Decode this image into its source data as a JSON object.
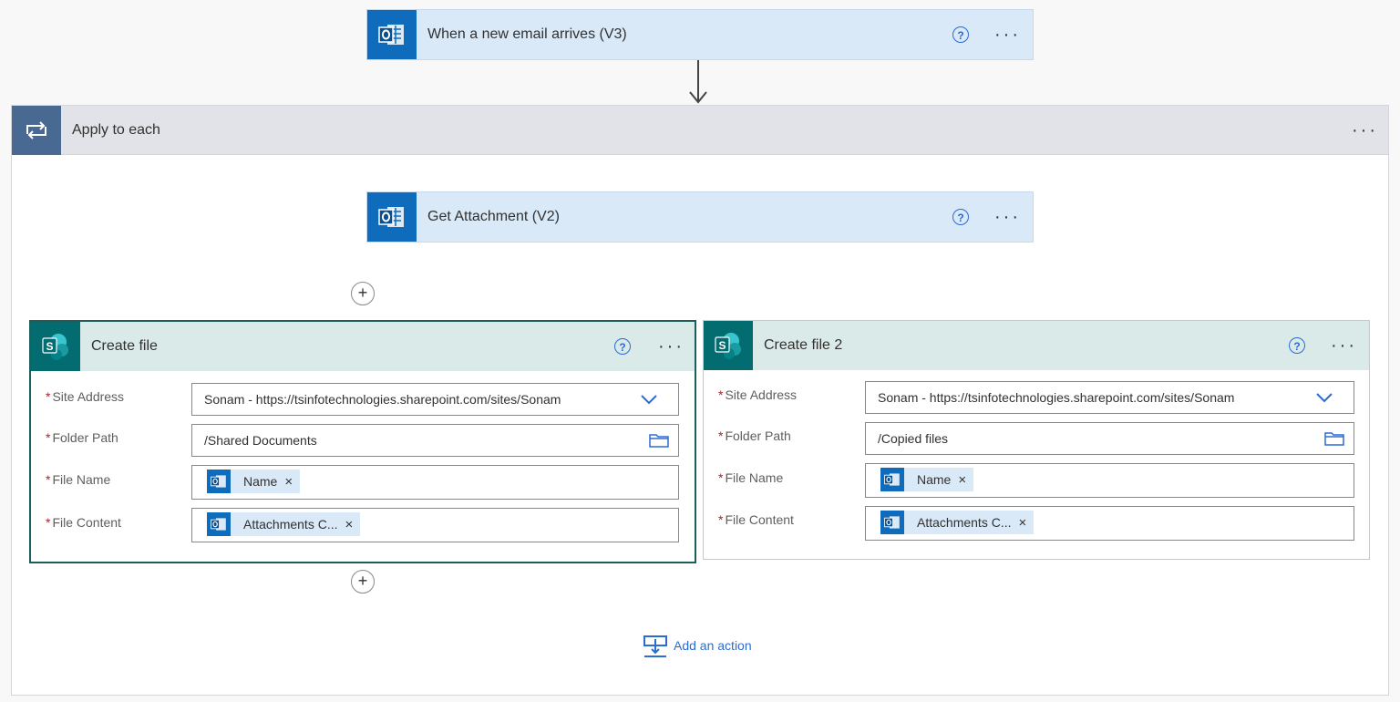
{
  "trigger": {
    "title": "When a new email arrives (V3)",
    "help": "?",
    "more": "···",
    "icon": "outlook-icon"
  },
  "loop": {
    "title": "Apply to each",
    "more": "···",
    "icon": "loop-icon"
  },
  "get_attachment": {
    "title": "Get Attachment (V2)",
    "help": "?",
    "more": "···",
    "icon": "outlook-icon"
  },
  "create_file": {
    "title": "Create file",
    "help": "?",
    "more": "···",
    "icon": "sharepoint-icon",
    "fields": {
      "site_address": {
        "label": "Site Address",
        "value": "Sonam - https://tsinfotechnologies.sharepoint.com/sites/Sonam"
      },
      "folder_path": {
        "label": "Folder Path",
        "value": "/Shared Documents"
      },
      "file_name": {
        "label": "File Name",
        "token": "Name"
      },
      "file_content": {
        "label": "File Content",
        "token": "Attachments C..."
      }
    }
  },
  "create_file_2": {
    "title": "Create file 2",
    "help": "?",
    "more": "···",
    "icon": "sharepoint-icon",
    "fields": {
      "site_address": {
        "label": "Site Address",
        "value": "Sonam - https://tsinfotechnologies.sharepoint.com/sites/Sonam"
      },
      "folder_path": {
        "label": "Folder Path",
        "value": "/Copied files"
      },
      "file_name": {
        "label": "File Name",
        "token": "Name"
      },
      "file_content": {
        "label": "File Content",
        "token": "Attachments C..."
      }
    }
  },
  "common": {
    "required_mark": "*",
    "token_remove": "×",
    "plus": "+",
    "sharepoint_letter": "S"
  },
  "add_action": {
    "label": "Add an action"
  },
  "colors": {
    "outlook_blue": "#0f6cbd",
    "sharepoint_teal": "#036c70",
    "loop_blue": "#486991",
    "accent": "#2b6cd3",
    "selected_border": "#1b5f5a"
  }
}
